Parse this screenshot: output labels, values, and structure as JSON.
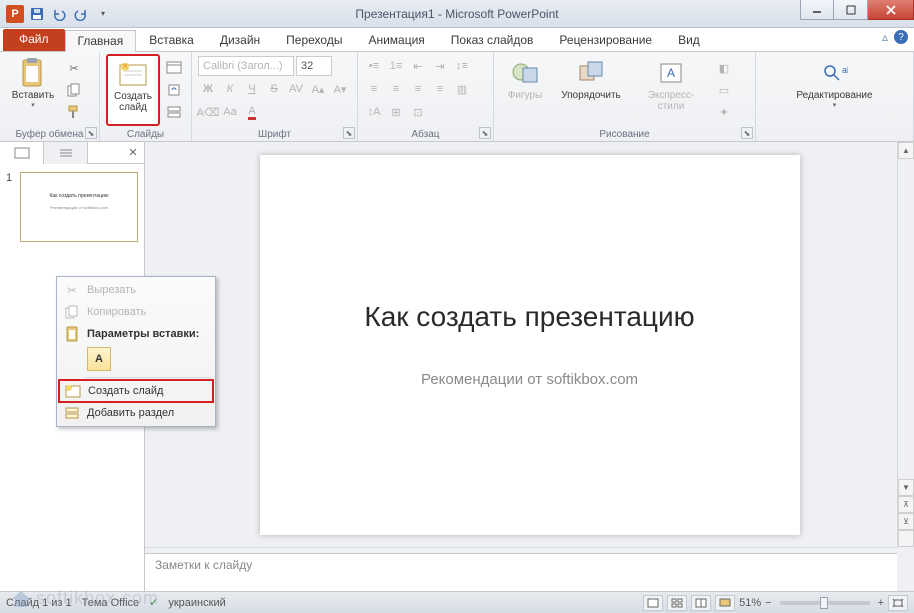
{
  "title": "Презентация1 - Microsoft PowerPoint",
  "app_icon_letter": "P",
  "qat": {
    "save": "save",
    "undo": "undo",
    "redo": "redo",
    "start": "start"
  },
  "tabs": {
    "file": "Файл",
    "items": [
      "Главная",
      "Вставка",
      "Дизайн",
      "Переходы",
      "Анимация",
      "Показ слайдов",
      "Рецензирование",
      "Вид"
    ],
    "active_index": 0
  },
  "ribbon": {
    "clipboard": {
      "label": "Буфер обмена",
      "paste": "Вставить"
    },
    "slides": {
      "label": "Слайды",
      "new_slide": "Создать\nслайд"
    },
    "font": {
      "label": "Шрифт",
      "name_placeholder": "Calibri (Загол...)",
      "size": "32"
    },
    "paragraph": {
      "label": "Абзац"
    },
    "drawing": {
      "label": "Рисование",
      "shapes": "Фигуры",
      "arrange": "Упорядочить",
      "quick_styles": "Экспресс-стили"
    },
    "editing": {
      "label": "",
      "edit": "Редактирование"
    }
  },
  "thumb": {
    "num": "1",
    "title": "Как создать презентацию",
    "subtitle": "Рекомендации от softikbox.com"
  },
  "slide": {
    "title": "Как создать презентацию",
    "subtitle": "Рекомендации от softikbox.com"
  },
  "notes_placeholder": "Заметки к слайду",
  "context_menu": {
    "cut": "Вырезать",
    "copy": "Копировать",
    "paste_header": "Параметры вставки:",
    "paste_opt": "A",
    "new_slide": "Создать слайд",
    "add_section": "Добавить раздел"
  },
  "statusbar": {
    "slide_info": "Слайд 1 из 1",
    "theme": "Тема Office",
    "lang": "украинский",
    "zoom": "51%"
  },
  "watermark": "softikbox.com"
}
